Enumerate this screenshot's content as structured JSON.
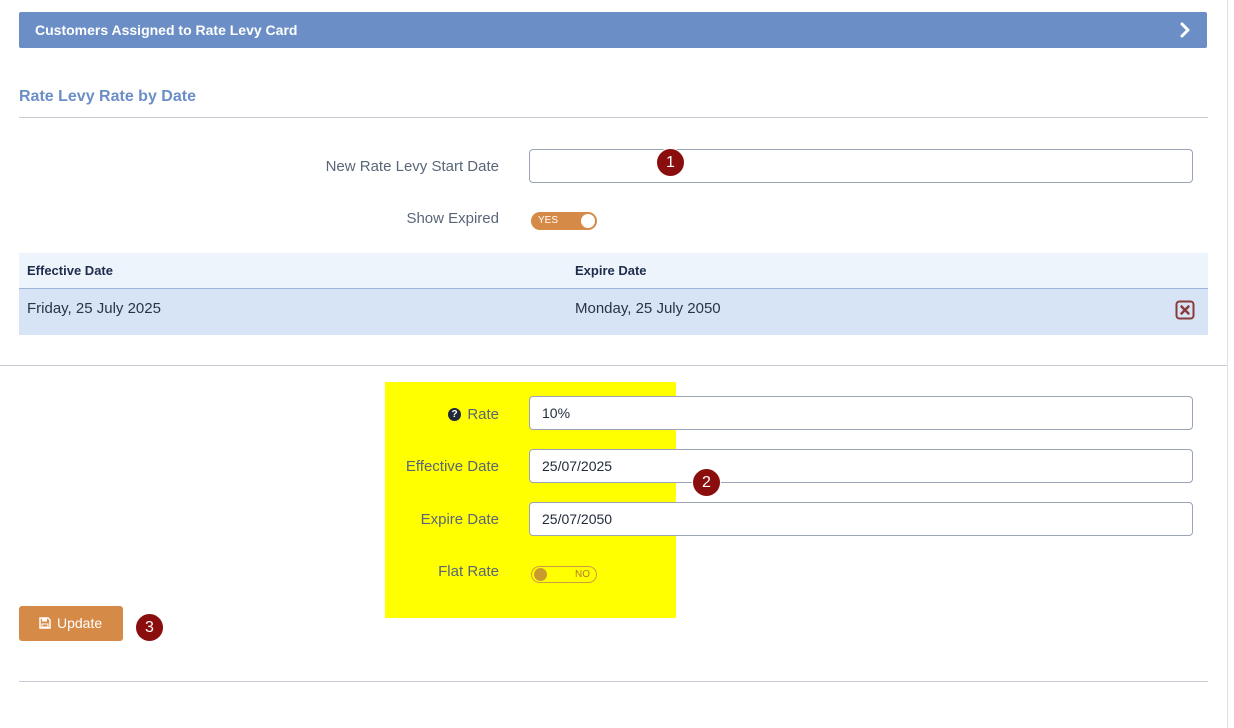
{
  "header": {
    "title": "Customers Assigned to Rate Levy Card",
    "expand_icon": "chevron-right-icon"
  },
  "section": {
    "title": "Rate Levy Rate by Date"
  },
  "filters": {
    "start_date_label": "New Rate Levy Start Date",
    "start_date_value": "",
    "show_expired_label": "Show Expired",
    "show_expired_state": "YES"
  },
  "table": {
    "columns": [
      "Effective Date",
      "Expire Date"
    ],
    "rows": [
      {
        "effective": "Friday, 25 July 2025",
        "expire": "Monday, 25 July 2050",
        "delete_icon": "close-box-icon"
      }
    ]
  },
  "form": {
    "rate_label": "Rate",
    "rate_value": "10%",
    "effective_label": "Effective Date",
    "effective_value": "25/07/2025",
    "expire_label": "Expire Date",
    "expire_value": "25/07/2050",
    "flat_rate_label": "Flat Rate",
    "flat_rate_state": "NO",
    "help_icon": "?"
  },
  "actions": {
    "update_label": "Update"
  },
  "markers": [
    "1",
    "2",
    "3"
  ],
  "colors": {
    "header_bg": "#6b8ec6",
    "accent": "#d68a47",
    "highlight": "#ffff00",
    "marker": "#8b0e0e"
  }
}
